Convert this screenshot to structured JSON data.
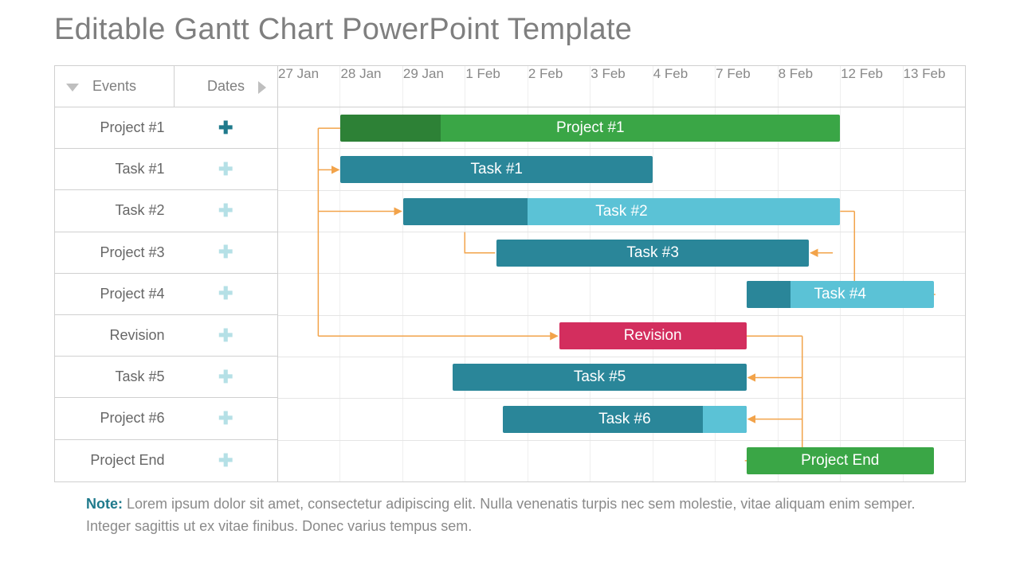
{
  "title": "Editable Gantt Chart PowerPoint Template",
  "colors": {
    "green": "#3aa646",
    "teal": "#2a8699",
    "cyan": "#5bc2d6",
    "pink": "#d32e5e",
    "orange": "#f2a34a"
  },
  "header": {
    "events": "Events",
    "dates": "Dates",
    "cols": [
      "27 Jan",
      "28 Jan",
      "29 Jan",
      "1 Feb",
      "2 Feb",
      "3 Feb",
      "4 Feb",
      "7 Feb",
      "8 Feb",
      "12 Feb",
      "13 Feb"
    ]
  },
  "rows": [
    {
      "label": "Project #1",
      "expand": "dark"
    },
    {
      "label": "Task #1",
      "expand": "light"
    },
    {
      "label": "Task #2",
      "expand": "light"
    },
    {
      "label": "Project #3",
      "expand": "light"
    },
    {
      "label": "Project #4",
      "expand": "light"
    },
    {
      "label": "Revision",
      "expand": "light"
    },
    {
      "label": "Task #5",
      "expand": "light"
    },
    {
      "label": "Project #6",
      "expand": "light"
    },
    {
      "label": "Project End",
      "expand": "light"
    }
  ],
  "bars": [
    {
      "row": 0,
      "label": "Project #1",
      "start": 1,
      "end": 9,
      "fill": "green",
      "progress_cols": 1.6
    },
    {
      "row": 1,
      "label": "Task #1",
      "start": 1,
      "end": 6,
      "fill": "teal"
    },
    {
      "row": 2,
      "label": "Task #2",
      "start": 2,
      "end": 9,
      "fill": "cyan",
      "progress_cols": 2.0,
      "prog_fill": "teal"
    },
    {
      "row": 3,
      "label": "Task #3",
      "start": 3.5,
      "end": 8.5,
      "fill": "teal"
    },
    {
      "row": 4,
      "label": "Task #4",
      "start": 7.5,
      "end": 10.5,
      "fill": "cyan",
      "progress_cols": 0.7,
      "prog_fill": "teal"
    },
    {
      "row": 5,
      "label": "Revision",
      "start": 4.5,
      "end": 7.5,
      "fill": "pink"
    },
    {
      "row": 6,
      "label": "Task #5",
      "start": 2.8,
      "end": 7.5,
      "fill": "teal"
    },
    {
      "row": 7,
      "label": "Task #6",
      "start": 3.6,
      "end": 7.5,
      "fill": "teal",
      "tail_fill": "cyan",
      "tail_cols": 0.7
    },
    {
      "row": 8,
      "label": "Project End",
      "start": 7.5,
      "end": 10.5,
      "fill": "green"
    }
  ],
  "note_prefix": "Note:",
  "note_text": " Lorem ipsum dolor sit amet, consectetur adipiscing elit. Nulla venenatis turpis nec sem molestie, vitae aliquam enim semper. Integer sagittis ut ex vitae finibus. Donec varius tempus sem.",
  "chart_data": {
    "type": "gantt",
    "title": "Editable Gantt Chart PowerPoint Template",
    "timeline": [
      "27 Jan",
      "28 Jan",
      "29 Jan",
      "1 Feb",
      "2 Feb",
      "3 Feb",
      "4 Feb",
      "7 Feb",
      "8 Feb",
      "12 Feb",
      "13 Feb"
    ],
    "tasks": [
      {
        "name": "Project #1",
        "bar_label": "Project #1",
        "start": "28 Jan",
        "end": "12 Feb",
        "color": "green",
        "progress_pct": 20
      },
      {
        "name": "Task #1",
        "bar_label": "Task #1",
        "start": "28 Jan",
        "end": "4 Feb",
        "color": "teal",
        "depends_on": [
          "Project #1"
        ]
      },
      {
        "name": "Task #2",
        "bar_label": "Task #2",
        "start": "29 Jan",
        "end": "12 Feb",
        "color": "cyan",
        "progress_pct": 29,
        "depends_on": [
          "Project #1"
        ]
      },
      {
        "name": "Project #3",
        "bar_label": "Task #3",
        "start": "1 Feb",
        "end": "8 Feb",
        "color": "teal",
        "depends_on": [
          "Task #2"
        ]
      },
      {
        "name": "Project #4",
        "bar_label": "Task #4",
        "start": "7 Feb",
        "end": "13 Feb",
        "color": "cyan",
        "progress_pct": 23,
        "depends_on": [
          "Project #3"
        ]
      },
      {
        "name": "Revision",
        "bar_label": "Revision",
        "start": "2 Feb",
        "end": "7 Feb",
        "color": "pink",
        "depends_on": [
          "Project #1"
        ]
      },
      {
        "name": "Task #5",
        "bar_label": "Task #5",
        "start": "29 Jan",
        "end": "7 Feb",
        "color": "teal",
        "depends_on": [
          "Revision"
        ]
      },
      {
        "name": "Project #6",
        "bar_label": "Task #6",
        "start": "1 Feb",
        "end": "7 Feb",
        "color": "teal",
        "depends_on": [
          "Revision"
        ]
      },
      {
        "name": "Project End",
        "bar_label": "Project End",
        "start": "7 Feb",
        "end": "13 Feb",
        "color": "green",
        "depends_on": [
          "Revision"
        ]
      }
    ]
  }
}
